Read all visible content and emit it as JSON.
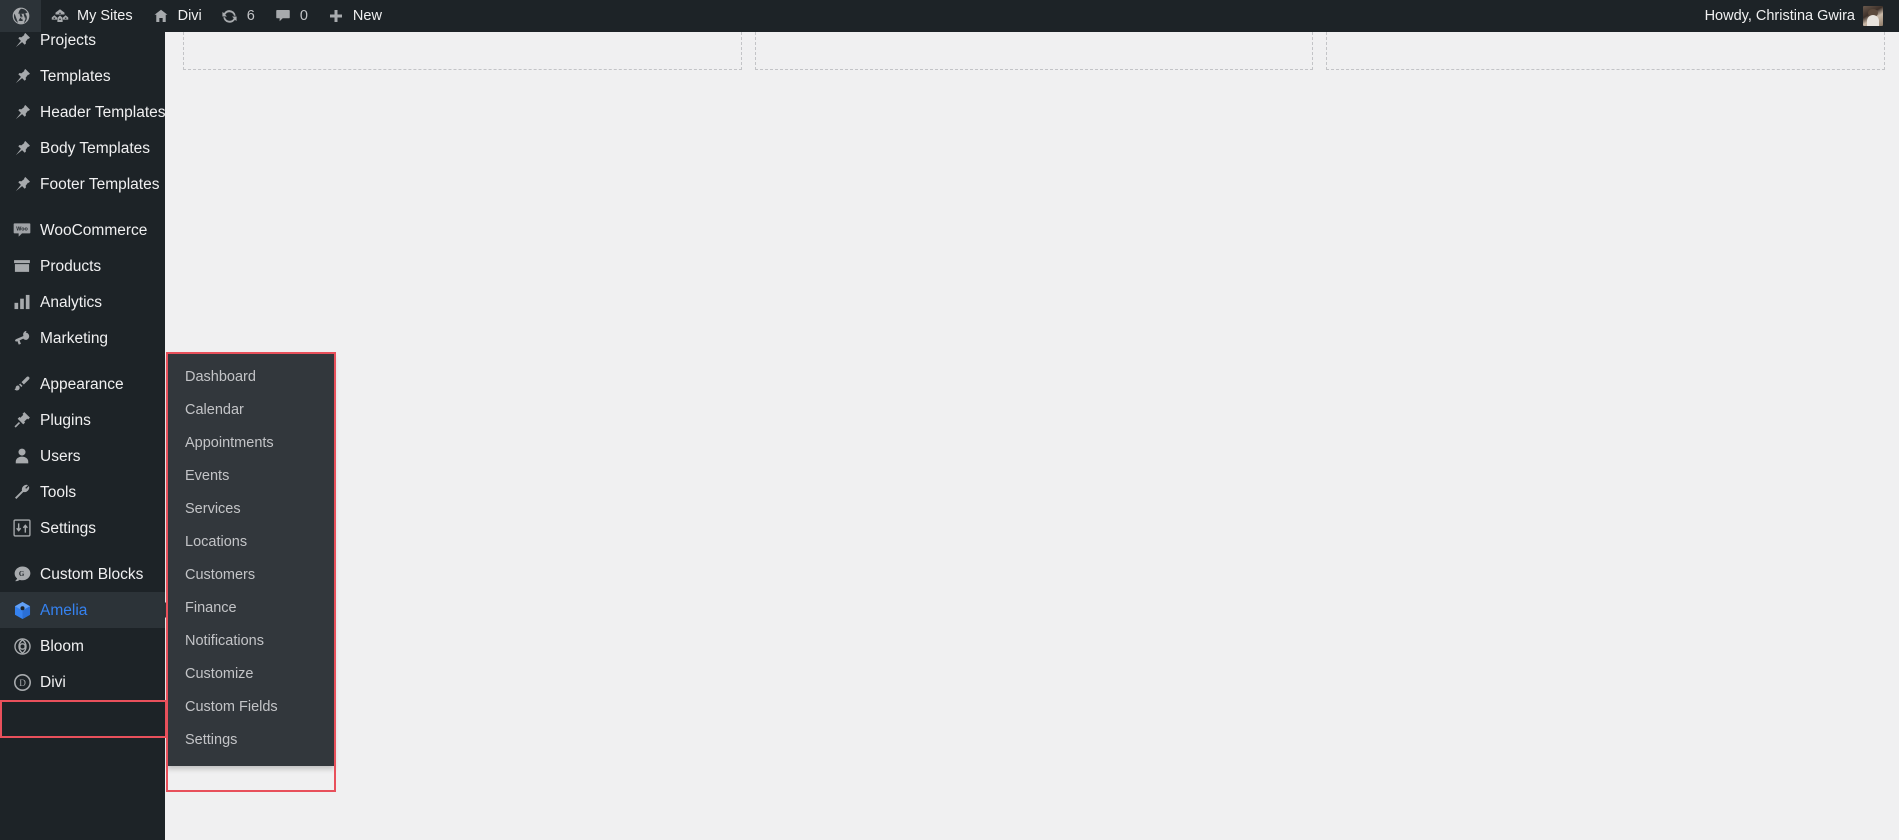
{
  "adminbar": {
    "logo_icon": "wordpress-logo-icon",
    "items": [
      {
        "icon": "my-sites-icon",
        "label": "My Sites"
      },
      {
        "icon": "home-icon",
        "label": "Divi"
      },
      {
        "icon": "updates-icon",
        "label": "6"
      },
      {
        "icon": "comments-icon",
        "label": "0"
      },
      {
        "icon": "plus-icon",
        "label": "New"
      }
    ],
    "howdy": "Howdy, Christina Gwira",
    "avatar_name": "user-avatar"
  },
  "sidebar": {
    "items": [
      {
        "label": "Projects",
        "icon": "pin-icon",
        "current": false
      },
      {
        "label": "Templates",
        "icon": "pin-icon",
        "current": false
      },
      {
        "label": "Header Templates",
        "icon": "pin-icon",
        "current": false
      },
      {
        "label": "Body Templates",
        "icon": "pin-icon",
        "current": false
      },
      {
        "label": "Footer Templates",
        "icon": "pin-icon",
        "current": false
      },
      {
        "label": "WooCommerce",
        "icon": "woo-icon",
        "current": false,
        "sep_before": true
      },
      {
        "label": "Products",
        "icon": "products-icon",
        "current": false
      },
      {
        "label": "Analytics",
        "icon": "analytics-icon",
        "current": false
      },
      {
        "label": "Marketing",
        "icon": "megaphone-icon",
        "current": false
      },
      {
        "label": "Appearance",
        "icon": "paintbrush-icon",
        "current": false,
        "sep_before": true
      },
      {
        "label": "Plugins",
        "icon": "plug-icon",
        "current": false
      },
      {
        "label": "Users",
        "icon": "user-icon",
        "current": false
      },
      {
        "label": "Tools",
        "icon": "wrench-icon",
        "current": false
      },
      {
        "label": "Settings",
        "icon": "sliders-icon",
        "current": false
      },
      {
        "label": "Custom Blocks",
        "icon": "genesis-icon",
        "current": false,
        "sep_before": true
      },
      {
        "label": "Amelia",
        "icon": "amelia-icon",
        "current": true
      },
      {
        "label": "Bloom",
        "icon": "bloom-icon",
        "current": false
      },
      {
        "label": "Divi",
        "icon": "divi-icon",
        "current": false
      }
    ]
  },
  "submenu": {
    "parent": "Amelia",
    "items": [
      {
        "label": "Dashboard"
      },
      {
        "label": "Calendar"
      },
      {
        "label": "Appointments"
      },
      {
        "label": "Events"
      },
      {
        "label": "Services"
      },
      {
        "label": "Locations"
      },
      {
        "label": "Customers"
      },
      {
        "label": "Finance"
      },
      {
        "label": "Notifications"
      },
      {
        "label": "Customize"
      },
      {
        "label": "Custom Fields"
      },
      {
        "label": "Settings"
      }
    ]
  },
  "content": {
    "placeholder_columns": 3
  },
  "colors": {
    "adminbar_bg": "#1d2327",
    "sidebar_bg": "#1d2327",
    "submenu_bg": "#32373c",
    "content_bg": "#f0f0f1",
    "accent_blue": "#3582f0",
    "highlight_red": "#e8505b",
    "text_light": "#f0f0f1",
    "text_muted": "#c3c4c7"
  }
}
